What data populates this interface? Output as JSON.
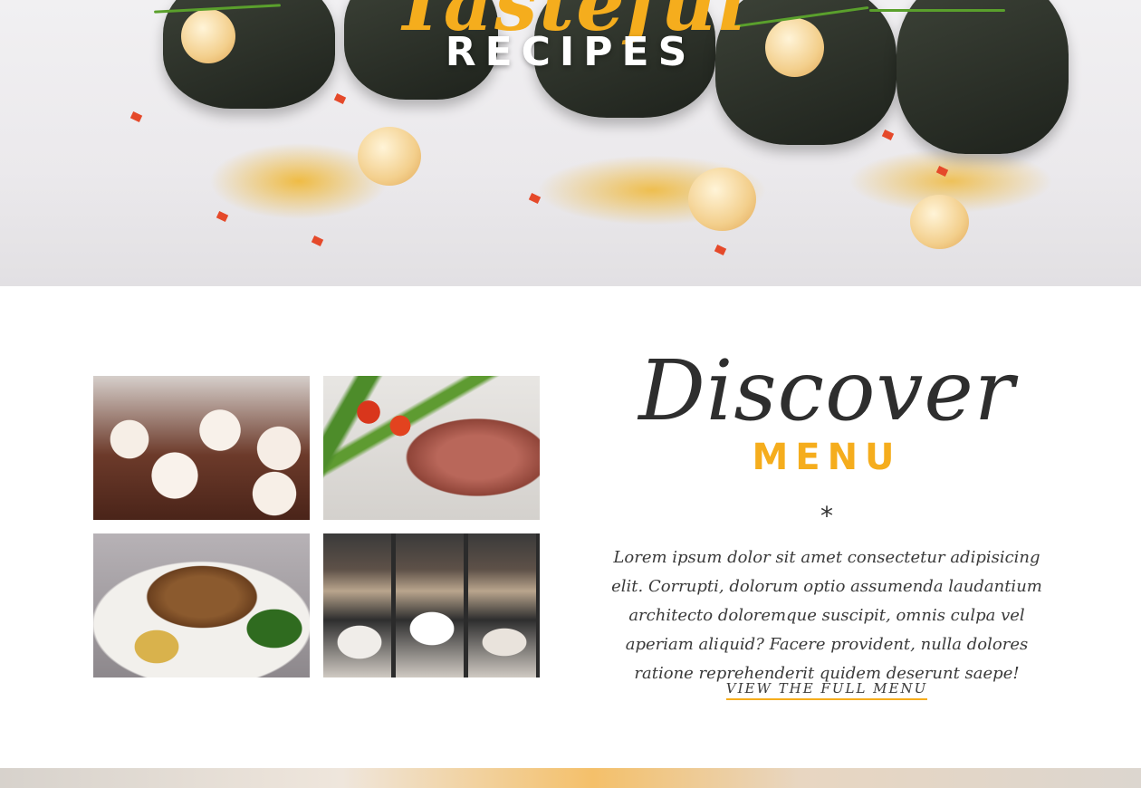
{
  "hero": {
    "script_text": "Tasteful",
    "caps_text": "RECIPES"
  },
  "gallery": {
    "items": [
      {
        "name": "cupcakes"
      },
      {
        "name": "steak-with-asparagus"
      },
      {
        "name": "grilled-pork-chop"
      },
      {
        "name": "gelato-display"
      }
    ]
  },
  "menu": {
    "script_text": "Discover",
    "caps_text": "MENU",
    "divider": "*",
    "description": "Lorem ipsum dolor sit amet consectetur adipisicing elit. Corrupti, dolorum optio assumenda laudantium architecto doloremque suscipit, omnis culpa vel aperiam aliquid? Facere provident, nulla dolores ratione reprehenderit quidem deserunt saepe!",
    "link_label": "VIEW THE FULL MENU"
  },
  "colors": {
    "accent": "#f5ad1d",
    "text_dark": "#2e2e2e",
    "background": "#ffffff"
  }
}
